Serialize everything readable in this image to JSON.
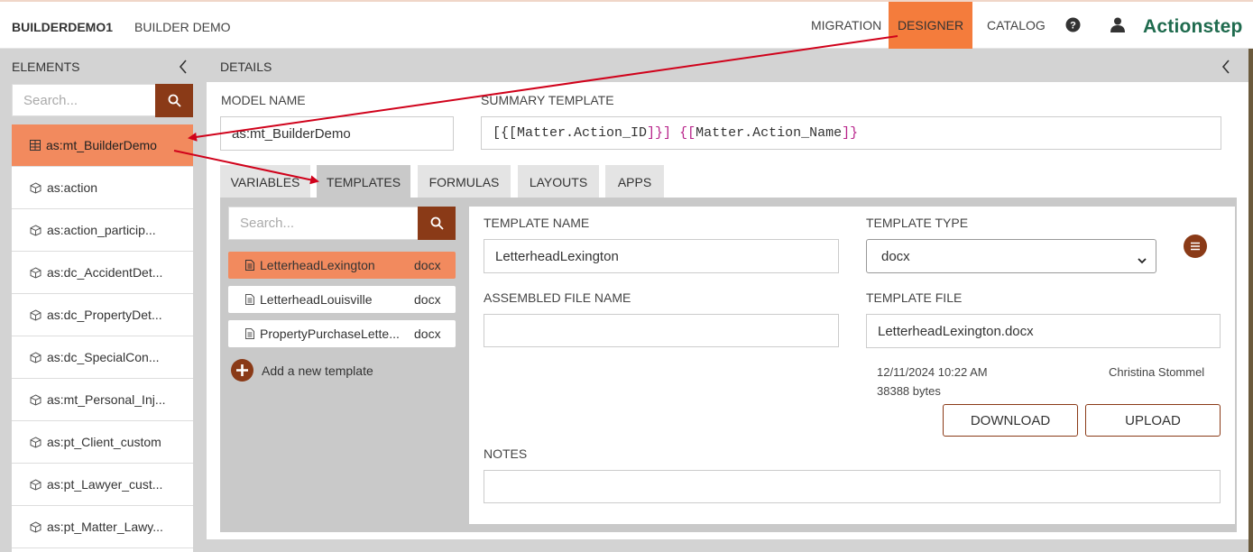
{
  "header": {
    "app_code": "BUILDERDEMO1",
    "app_name": "BUILDER DEMO",
    "nav": [
      "MIGRATION",
      "DESIGNER",
      "CATALOG"
    ],
    "active_nav": "DESIGNER",
    "logo_text": "Actionstep",
    "icons": [
      "help-icon",
      "user-icon"
    ]
  },
  "elements_panel": {
    "title": "ELEMENTS",
    "search_placeholder": "Search...",
    "items": [
      {
        "label": "as:mt_BuilderDemo",
        "icon": "table-icon",
        "active": true
      },
      {
        "label": "as:action",
        "icon": "cube-icon"
      },
      {
        "label": "as:action_particip...",
        "icon": "cube-icon"
      },
      {
        "label": "as:dc_AccidentDet...",
        "icon": "cube-icon"
      },
      {
        "label": "as:dc_PropertyDet...",
        "icon": "cube-icon"
      },
      {
        "label": "as:dc_SpecialCon...",
        "icon": "cube-icon"
      },
      {
        "label": "as:mt_Personal_Inj...",
        "icon": "cube-icon"
      },
      {
        "label": "as:pt_Client_custom",
        "icon": "cube-icon"
      },
      {
        "label": "as:pt_Lawyer_cust...",
        "icon": "cube-icon"
      },
      {
        "label": "as:pt_Matter_Lawy...",
        "icon": "cube-icon"
      }
    ]
  },
  "details": {
    "title": "DETAILS",
    "model_name_label": "MODEL NAME",
    "model_name_value": "as:mt_BuilderDemo",
    "summary_label": "SUMMARY TEMPLATE",
    "summary_parts": [
      "[{[",
      "Matter.Action_ID",
      "]}]",
      " ",
      "{[",
      "Matter.Action_Name",
      "]}"
    ],
    "tabs": [
      "VARIABLES",
      "TEMPLATES",
      "FORMULAS",
      "LAYOUTS",
      "APPS"
    ],
    "active_tab": "TEMPLATES"
  },
  "templates": {
    "search_placeholder": "Search...",
    "items": [
      {
        "name": "LetterheadLexington",
        "ext": "docx",
        "active": true
      },
      {
        "name": "LetterheadLouisville",
        "ext": "docx"
      },
      {
        "name": "PropertyPurchaseLette...",
        "ext": "docx"
      }
    ],
    "add_label": "Add a new template"
  },
  "template_detail": {
    "name_label": "TEMPLATE NAME",
    "name_value": "LetterheadLexington",
    "type_label": "TEMPLATE TYPE",
    "type_value": "docx",
    "assembled_label": "ASSEMBLED FILE NAME",
    "assembled_value": "",
    "file_label": "TEMPLATE FILE",
    "file_value": "LetterheadLexington.docx",
    "file_date": "12/11/2024 10:22 AM",
    "file_size": "38388 bytes",
    "file_author": "Christina Stommel",
    "download_label": "DOWNLOAD",
    "upload_label": "UPLOAD",
    "notes_label": "NOTES",
    "notes_value": ""
  },
  "colors": {
    "accent": "#f47c3c",
    "brand_dark": "#8a3a17",
    "logo": "#1f6b4e",
    "annotation_arrow": "#d0021b"
  }
}
